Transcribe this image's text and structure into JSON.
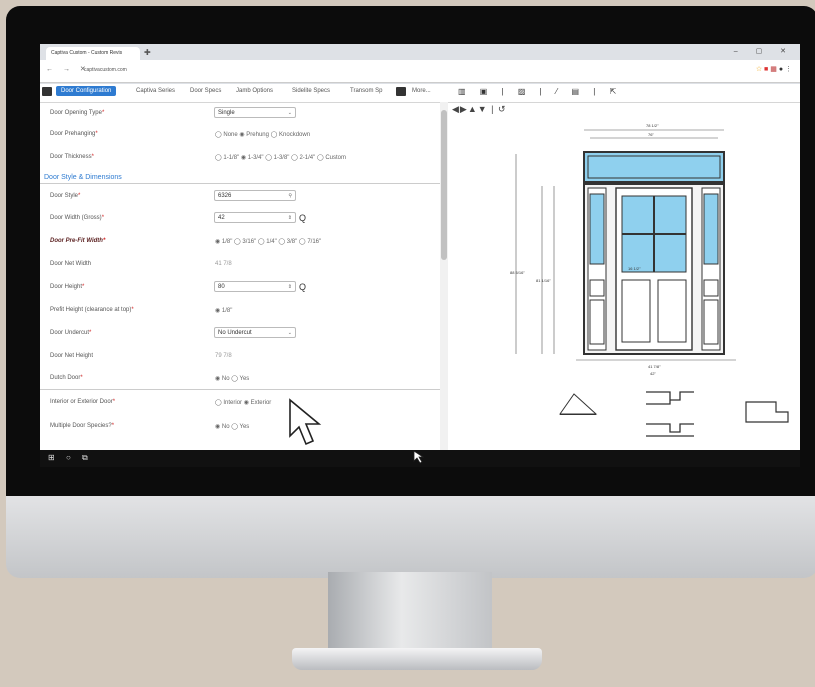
{
  "browser": {
    "tab_title": "Captiva Custom - Custom Revis",
    "url": "captivacustom.com",
    "window_controls": "– ▢ ✕"
  },
  "app_tabs": [
    "Door Configuration",
    "Captiva Series",
    "Door Specs",
    "Jamb Options",
    "Sidelite Specs",
    "Transom Sp",
    "More..."
  ],
  "form": {
    "rows": [
      {
        "label": "Door Opening Type",
        "required": true,
        "type": "select",
        "value": "Single"
      },
      {
        "label": "Door Prehanging",
        "required": true,
        "type": "radio",
        "options": "◯ None  ◉ Prehung  ◯ Knockdown"
      },
      {
        "label": "Door Thickness",
        "required": true,
        "type": "radio",
        "options": "◯ 1-1/8\"  ◉ 1-3/4\"  ◯ 1-3/8\"  ◯ 2-1/4\"  ◯ Custom"
      }
    ],
    "section_title": "Door Style & Dimensions",
    "rows2": [
      {
        "label": "Door Style",
        "required": true,
        "type": "input",
        "value": "6326",
        "suffix": "Q"
      },
      {
        "label": "Door Width (Gross)",
        "required": true,
        "type": "input",
        "value": "42",
        "suffix": "Q"
      },
      {
        "label": "Door Pre-Fit Width",
        "required": true,
        "type": "radio",
        "options": "◉ 1/8\"  ◯ 3/16\"  ◯ 1/4\"  ◯ 3/8\"  ◯ 7/16\""
      },
      {
        "label": "Door Net Width",
        "required": false,
        "type": "text",
        "value": "41 7/8"
      },
      {
        "label": "Door Height",
        "required": true,
        "type": "input",
        "value": "80",
        "suffix": "Q"
      },
      {
        "label": "Prefit Height (clearance at top)",
        "required": true,
        "type": "radio",
        "options": "◉ 1/8\""
      },
      {
        "label": "Door Undercut",
        "required": true,
        "type": "select",
        "value": "No Undercut"
      },
      {
        "label": "Door Net Height",
        "required": false,
        "type": "text",
        "value": "79 7/8"
      },
      {
        "label": "Dutch Door",
        "required": true,
        "type": "radio",
        "options": "◉ No  ◯ Yes"
      },
      {
        "label": "Interior or Exterior Door",
        "required": true,
        "type": "radio",
        "options": "◯ Interior  ◉ Exterior"
      },
      {
        "label": "Multiple Door Species?",
        "required": true,
        "type": "radio",
        "options": "◉ No  ◯ Yes"
      }
    ]
  },
  "drawing": {
    "dims": [
      "78 1/2\"",
      "76\"",
      "17\"",
      "12\"",
      "88 5/16\"",
      "81 1/16\"",
      "80\"",
      "41 7/8\"",
      "42\"",
      "16 1/2\""
    ]
  },
  "colors": {
    "accent": "#2e7bd1",
    "glass": "#8fd0ee"
  }
}
